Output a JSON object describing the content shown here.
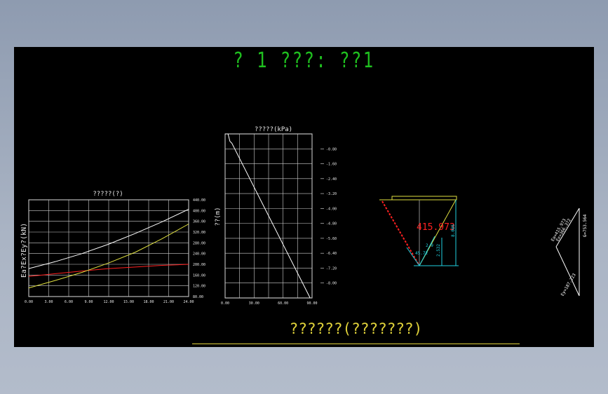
{
  "drawing": {
    "title": "? 1 ???: ??1",
    "caption": "??????(???????)"
  },
  "chart_data": [
    {
      "type": "line",
      "title": "?????(?)",
      "ylabel": "Ea?Ex?Ey?(kN)",
      "xlabel": "",
      "xlim": [
        0,
        24
      ],
      "ylim": [
        80,
        440
      ],
      "x_ticks": [
        "0.00",
        "3.00",
        "6.00",
        "9.00",
        "12.00",
        "15.00",
        "18.00",
        "21.00",
        "24.00"
      ],
      "y_ticks": [
        "80.00",
        "120.00",
        "160.00",
        "200.00",
        "240.00",
        "280.00",
        "320.00",
        "360.00",
        "400.00",
        "440.00"
      ],
      "grid": true,
      "series": [
        {
          "color": "#ffffff",
          "x": [
            0,
            4,
            8,
            12,
            16,
            20,
            24
          ],
          "values": [
            184,
            210,
            240,
            275,
            315,
            358,
            405
          ]
        },
        {
          "color": "#ff2020",
          "x": [
            0,
            4,
            8,
            12,
            16,
            20,
            24
          ],
          "values": [
            155,
            165,
            175,
            184,
            190,
            196,
            200
          ]
        },
        {
          "color": "#e0e040",
          "x": [
            0,
            4,
            8,
            12,
            16,
            20,
            24
          ],
          "values": [
            112,
            140,
            170,
            205,
            245,
            295,
            350
          ]
        }
      ]
    },
    {
      "type": "line",
      "title": "?????(kPa)",
      "ylabel": "??(m)",
      "xlabel": "",
      "xlim": [
        0,
        90
      ],
      "ylim": [
        0,
        -8.8
      ],
      "x_ticks": [
        "0.00",
        "30.00",
        "60.00",
        "90.00"
      ],
      "y_ticks": [
        "-0.80",
        "-1.60",
        "-2.40",
        "-3.20",
        "-4.00",
        "-4.80",
        "-5.60",
        "-6.40",
        "-7.20",
        "-8.00"
      ],
      "grid": true,
      "series": [
        {
          "color": "#ffffff",
          "x": [
            0,
            3,
            5,
            7,
            88
          ],
          "values": [
            0,
            0,
            -0.4,
            -0.5,
            -8.8
          ]
        }
      ]
    }
  ],
  "wedge": {
    "force_label": "415.973",
    "dims": [
      "8.006",
      "2.532",
      "2.9",
      "45.72"
    ]
  },
  "force_polygon": {
    "labels": [
      "Ea=415.973",
      "Ex=366.372",
      "Ey=187.223",
      "G=753.564"
    ]
  }
}
